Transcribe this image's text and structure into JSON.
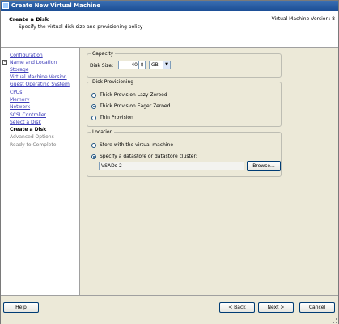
{
  "window": {
    "title": "Create New Virtual Machine"
  },
  "header": {
    "title": "Create a Disk",
    "subtitle": "Specify the virtual disk size and provisioning policy",
    "version": "Virtual Machine Version: 8"
  },
  "nav": {
    "items": [
      {
        "label": "Configuration",
        "state": "link"
      },
      {
        "label": "Name and Location",
        "state": "link"
      },
      {
        "label": "Storage",
        "state": "link"
      },
      {
        "label": "Virtual Machine Version",
        "state": "link"
      },
      {
        "label": "Guest Operating System",
        "state": "link"
      },
      {
        "label": "CPUs",
        "state": "link"
      },
      {
        "label": "Memory",
        "state": "link"
      },
      {
        "label": "Network",
        "state": "link"
      },
      {
        "label": "SCSI Controller",
        "state": "link"
      },
      {
        "label": "Select a Disk",
        "state": "link"
      },
      {
        "label": "Create a Disk",
        "state": "current"
      },
      {
        "label": "Advanced Options",
        "state": "future"
      },
      {
        "label": "Ready to Complete",
        "state": "future"
      }
    ]
  },
  "capacity": {
    "title": "Capacity",
    "disk_size_label": "Disk Size:",
    "disk_size_value": "40",
    "unit_value": "GB"
  },
  "provisioning": {
    "title": "Disk Provisioning",
    "options": [
      {
        "label": "Thick Provision Lazy Zeroed",
        "selected": false
      },
      {
        "label": "Thick Provision Eager Zeroed",
        "selected": true
      },
      {
        "label": "Thin Provision",
        "selected": false
      }
    ]
  },
  "location": {
    "title": "Location",
    "options": [
      {
        "label": "Store with the virtual machine",
        "selected": false
      },
      {
        "label": "Specify a datastore or datastore cluster:",
        "selected": true
      }
    ],
    "datastore_value": "VSADs-2",
    "browse_label": "Browse..."
  },
  "footer": {
    "help_label": "Help",
    "back_label": "< Back",
    "next_label": "Next >",
    "cancel_label": "Cancel"
  }
}
